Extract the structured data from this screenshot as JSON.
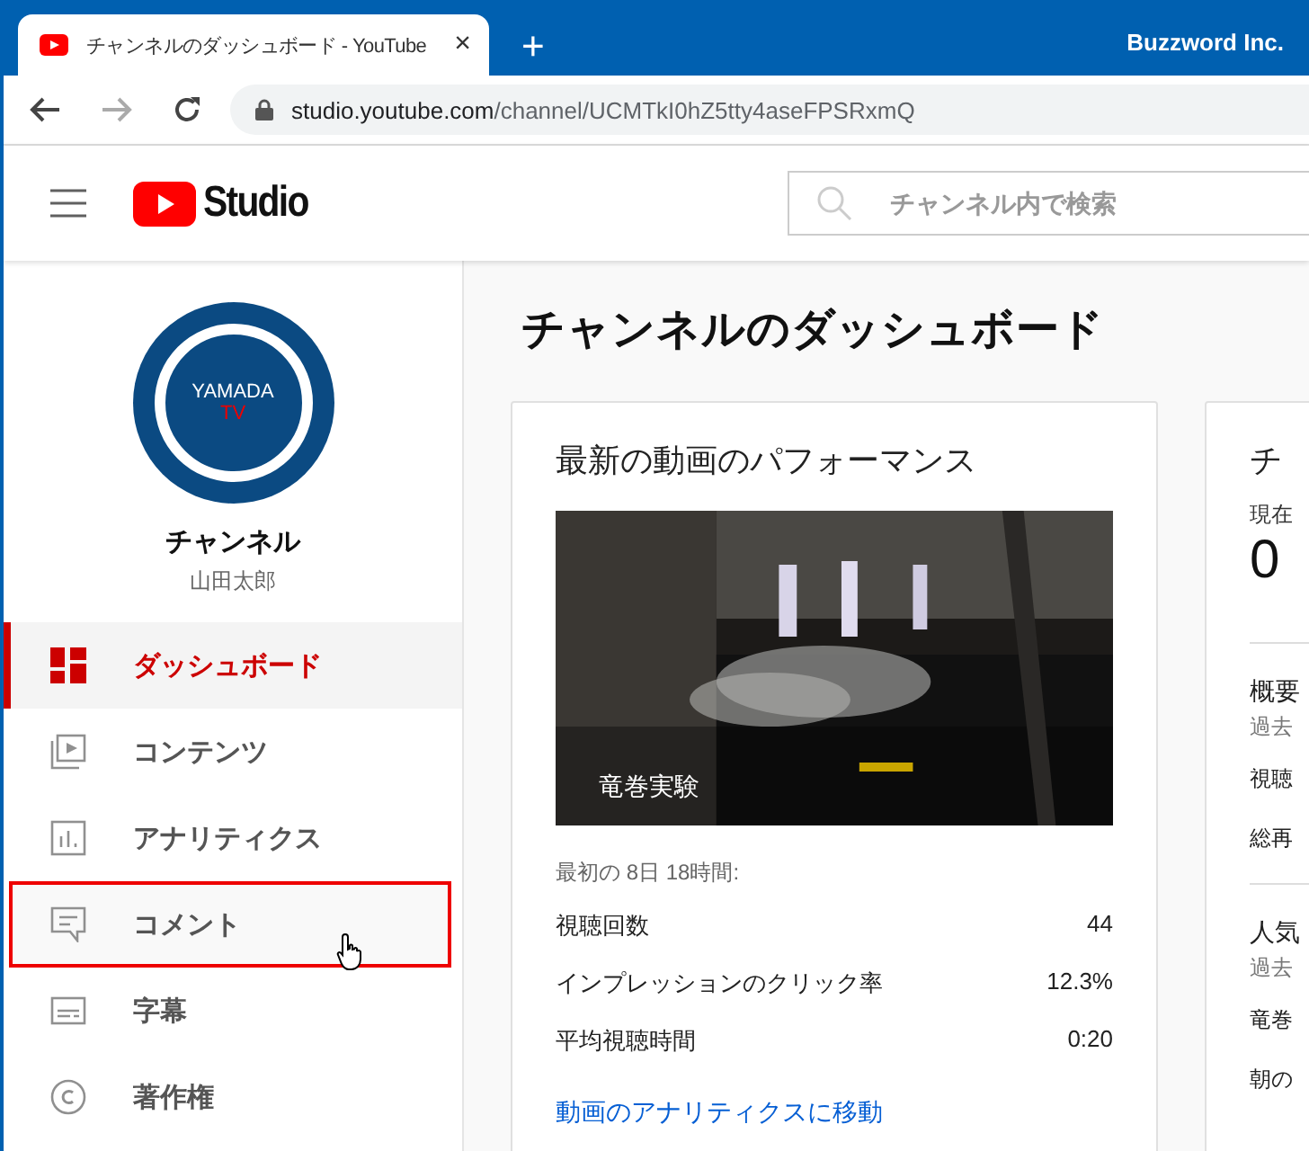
{
  "browser": {
    "tab": {
      "title": "チャンネルのダッシュボード - YouTube",
      "close": "×"
    },
    "new_tab": "+",
    "profile": "Buzzword Inc.",
    "url": {
      "host": "studio.youtube.com",
      "path": "/channel/UCMTkI0hZ5tty4aseFPSRxmQ"
    }
  },
  "header": {
    "logo": "Studio",
    "search": {
      "placeholder": "チャンネル内で検索"
    }
  },
  "channel": {
    "avatar_line1": "YAMADA",
    "avatar_line2": "TV",
    "title": "チャンネル",
    "name": "山田太郎"
  },
  "sidebar": {
    "items": [
      {
        "label": "ダッシュボード",
        "kind": "dashboard",
        "selected": true,
        "annotated": false
      },
      {
        "label": "コンテンツ",
        "kind": "content",
        "selected": false,
        "annotated": false
      },
      {
        "label": "アナリティクス",
        "kind": "analytics",
        "selected": false,
        "annotated": false
      },
      {
        "label": "コメント",
        "kind": "comments",
        "selected": false,
        "annotated": true
      },
      {
        "label": "字幕",
        "kind": "subtitles",
        "selected": false,
        "annotated": false
      },
      {
        "label": "著作権",
        "kind": "copyright",
        "selected": false,
        "annotated": false
      }
    ]
  },
  "main": {
    "title": "チャンネルのダッシュボード",
    "video_card": {
      "title": "最新の動画のパフォーマンス",
      "video": {
        "kind": "picture",
        "caption": "竜巻実験"
      },
      "period": "最初の 8日 18時間:",
      "stats": [
        {
          "label": "視聴回数",
          "value": "44"
        },
        {
          "label": "インプレッションのクリック率",
          "value": "12.3%"
        },
        {
          "label": "平均視聴時間",
          "value": "0:20"
        }
      ],
      "link": "動画のアナリティクスに移動"
    },
    "channel_card": {
      "title": "チ",
      "subscribers_label": "現在",
      "subscribers": "0",
      "summary_title": "概要",
      "summary_period": "過去",
      "summary_rows": [
        "視聴",
        "総再"
      ],
      "top_title": "人気",
      "top_period": "過去",
      "top_rows": [
        "竜巻",
        "朝の"
      ]
    }
  }
}
